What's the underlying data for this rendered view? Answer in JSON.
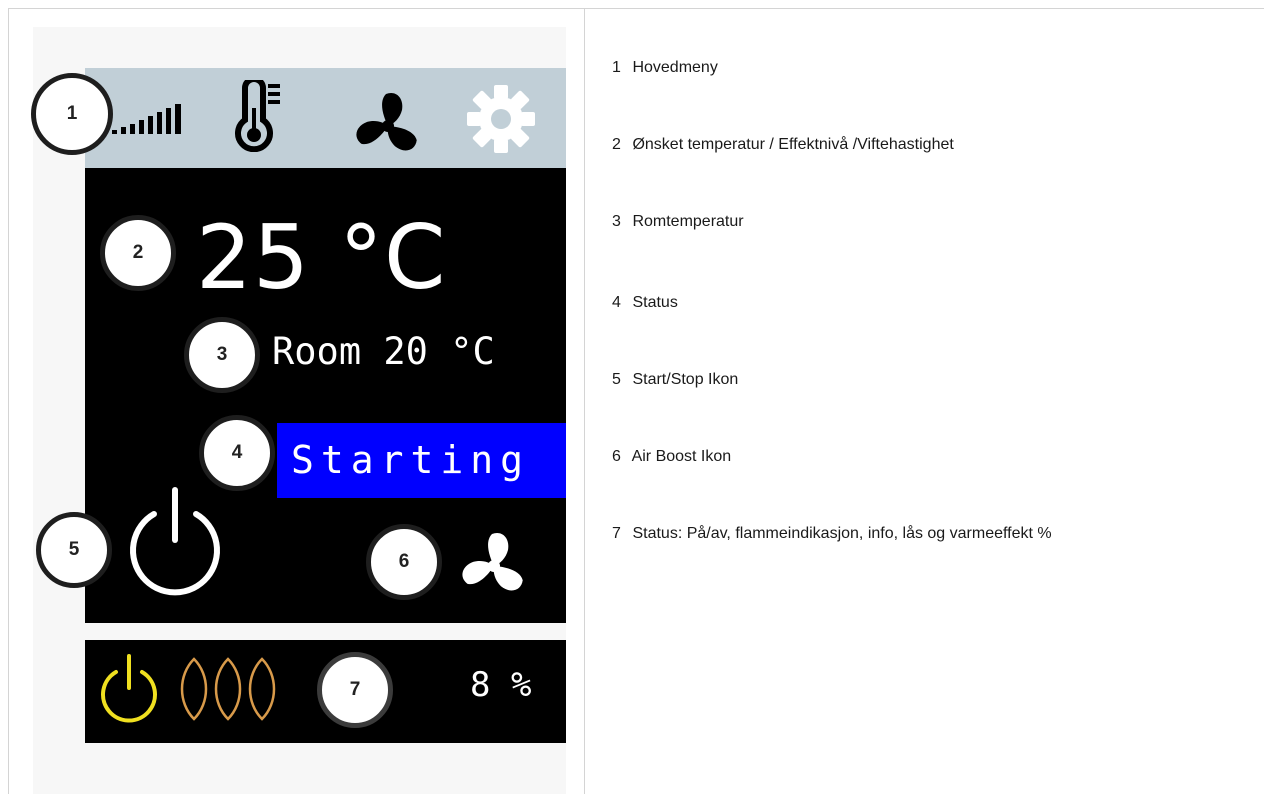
{
  "display": {
    "set_temperature": "25 °C",
    "room_temperature": "Room 20 °C",
    "status": "Starting",
    "heat_percent": "8 %"
  },
  "menu": {
    "icons": [
      "signal-level-icon",
      "thermometer-icon",
      "fan-icon",
      "gear-icon"
    ]
  },
  "callouts": [
    "1",
    "2",
    "3",
    "4",
    "5",
    "6",
    "7"
  ],
  "legend": [
    {
      "num": "1",
      "text": "Hovedmeny"
    },
    {
      "num": "2",
      "text": "Ønsket temperatur / Effektnivå /Viftehastighet"
    },
    {
      "num": "3",
      "text": "Romtemperatur"
    },
    {
      "num": "4",
      "text": "Status"
    },
    {
      "num": "5",
      "text": "Start/Stop Ikon"
    },
    {
      "num": "6",
      "text": "Air Boost Ikon"
    },
    {
      "num": "7",
      "text": "Status: På/av, flammeindikasjon, info, lås og varmeeffekt %"
    }
  ],
  "colors": {
    "menu_bar": "#c1cfd7",
    "status_highlight": "#0000ff",
    "power_indicator": "#f0e020",
    "flame_indicator": "#d89a4a",
    "gear": "#ffffff"
  }
}
